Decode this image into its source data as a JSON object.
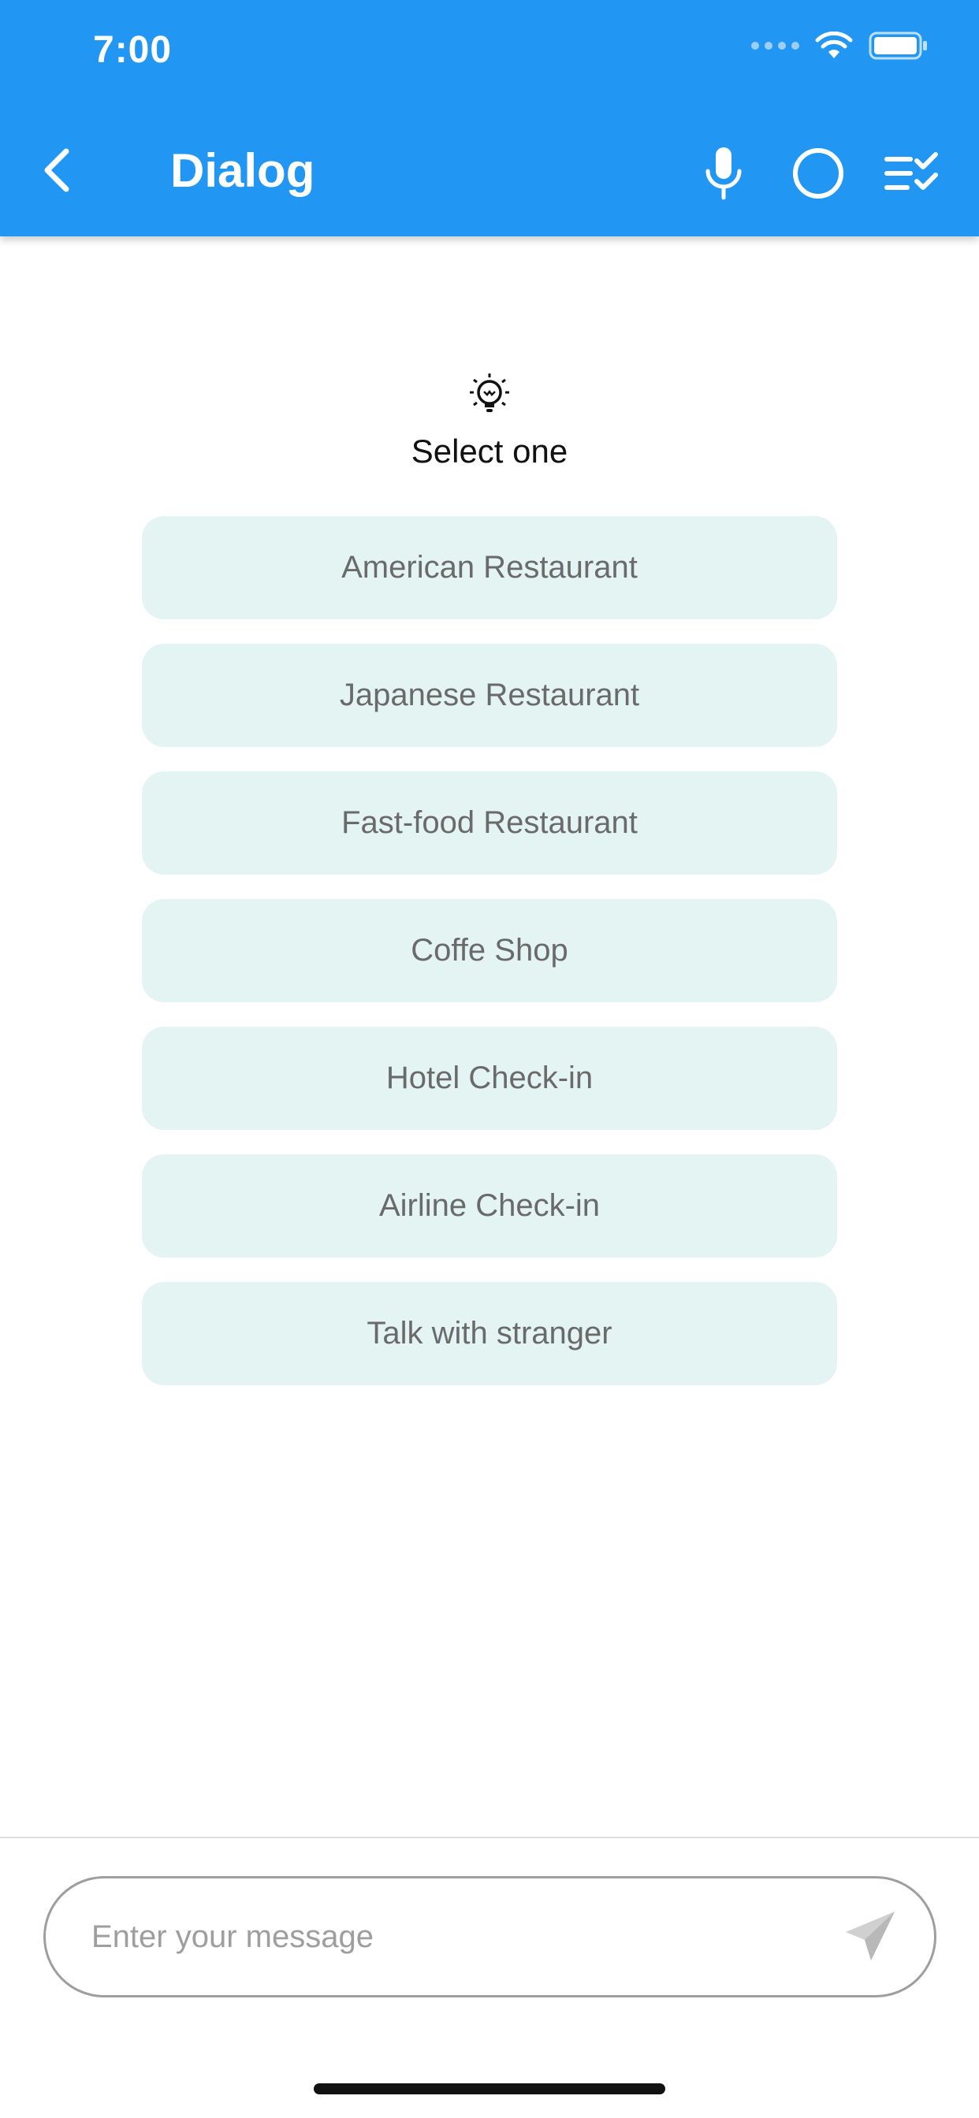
{
  "status_bar": {
    "time": "7:00"
  },
  "app_bar": {
    "title": "Dialog",
    "background_color": "#2196F3",
    "icons": [
      "back-chevron-icon",
      "microphone-icon",
      "circle-icon",
      "checklist-icon"
    ]
  },
  "prompt": {
    "icon": "lightbulb-icon",
    "text": "Select one"
  },
  "options": [
    {
      "label": "American Restaurant"
    },
    {
      "label": "Japanese Restaurant"
    },
    {
      "label": "Fast-food Restaurant"
    },
    {
      "label": "Coffe Shop"
    },
    {
      "label": "Hotel Check-in"
    },
    {
      "label": "Airline Check-in"
    },
    {
      "label": "Talk with stranger"
    }
  ],
  "option_background_color": "#E3F4F2",
  "composer": {
    "placeholder": "Enter your message",
    "value": "",
    "send_icon": "send-icon"
  }
}
